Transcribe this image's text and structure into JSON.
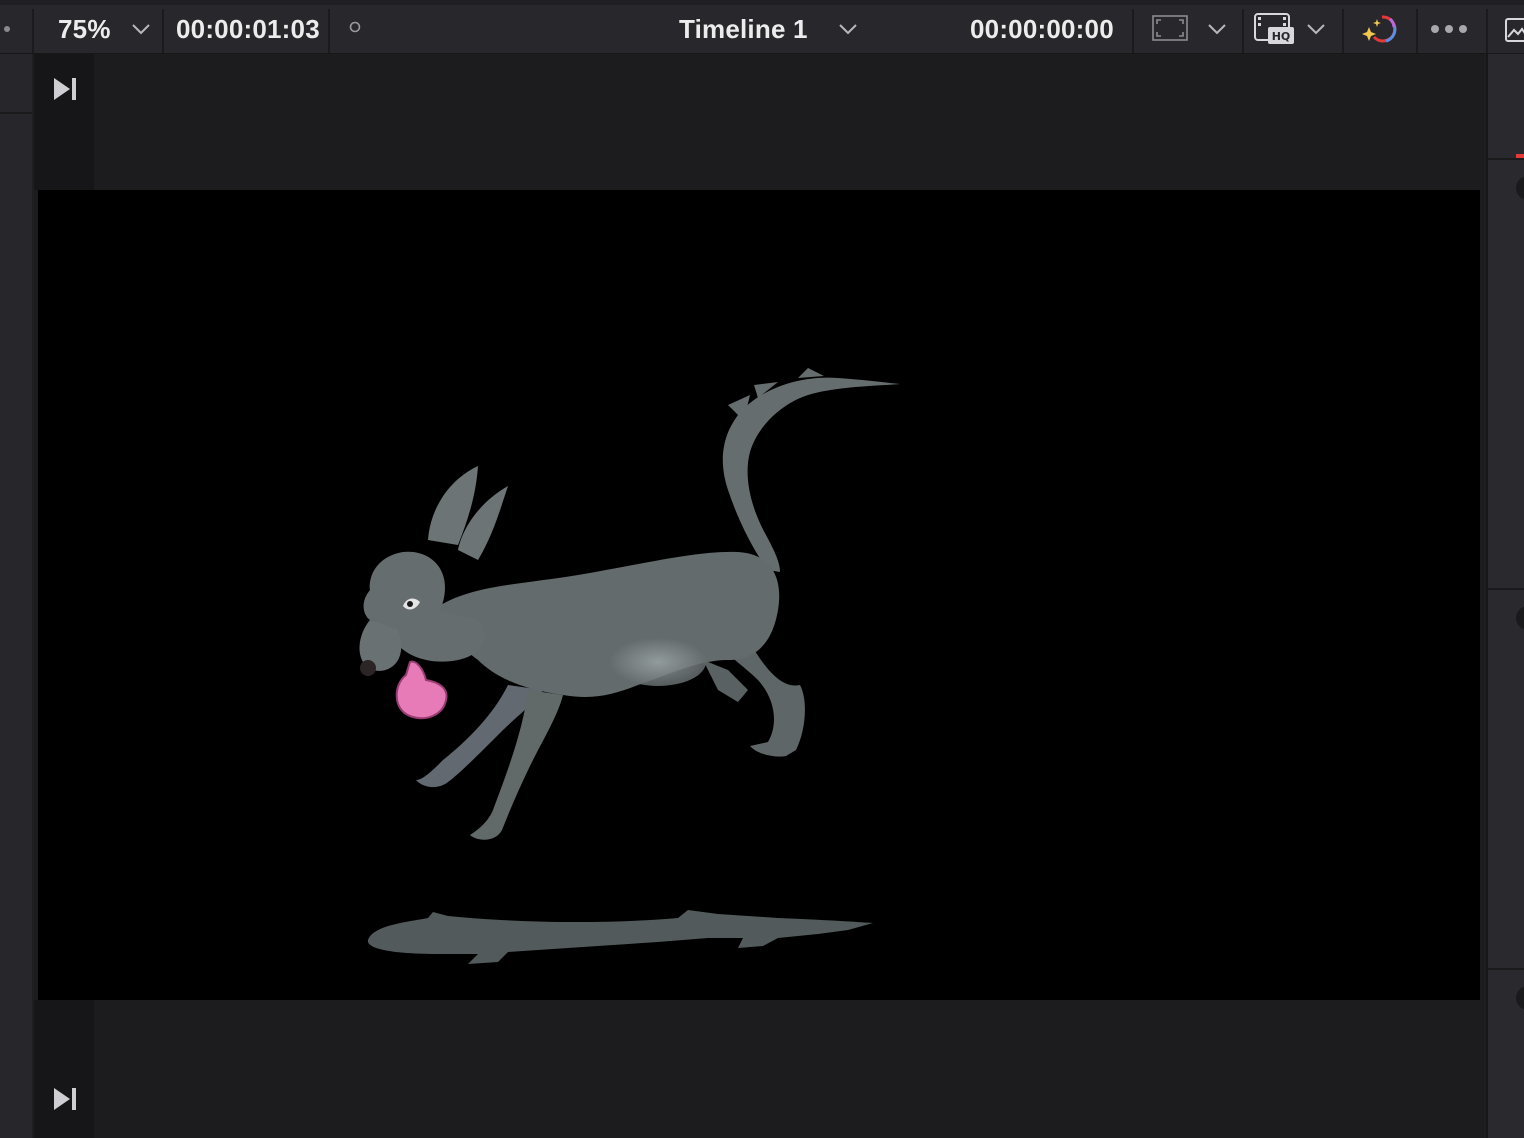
{
  "toolbar": {
    "zoom": "75%",
    "duration_timecode": "00:00:01:03",
    "timeline_name": "Timeline 1",
    "current_timecode": "00:00:00:00"
  },
  "icons": [
    "zoom-dropdown-chevron-icon",
    "record-dot-icon",
    "timeline-dropdown-chevron-icon",
    "viewer-frame-icon",
    "viewer-frame-dropdown-icon",
    "hq-playback-icon",
    "hq-dropdown-icon",
    "color-sparkle-icon",
    "more-options-icon",
    "image-icon",
    "jump-to-next-icon"
  ],
  "colors": {
    "accent_red": "#e5393a",
    "toolbar_bg": "#28282c",
    "viewer_bg": "#1c1c1f",
    "frame_bg": "#000000",
    "dog_body": "#616869",
    "tongue": "#e77bb8"
  }
}
